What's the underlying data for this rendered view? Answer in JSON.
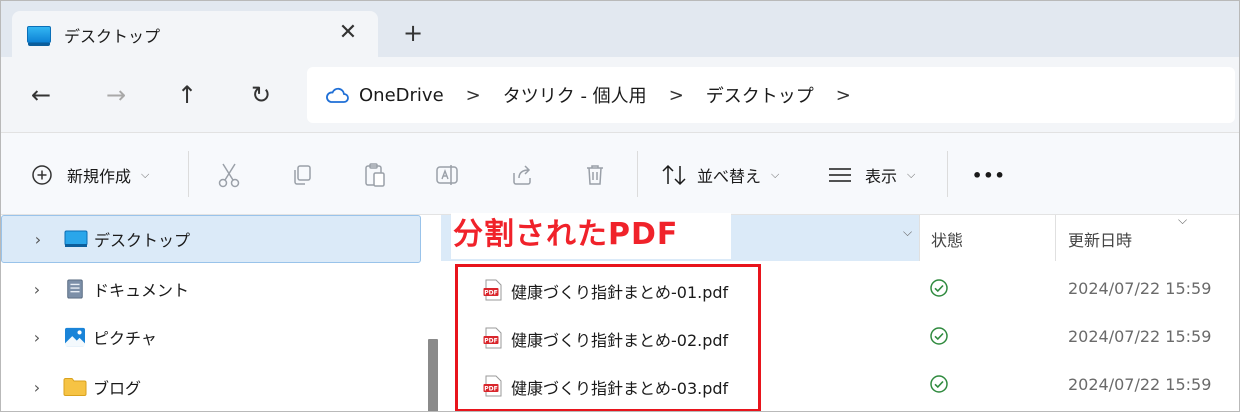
{
  "window": {
    "tab_title": "デスクトップ",
    "tab_close": "✕",
    "new_tab": "+"
  },
  "navigation": {
    "back": "←",
    "forward": "→",
    "up": "↑",
    "refresh": "↻"
  },
  "address_bar": {
    "breadcrumbs": [
      "OneDrive",
      "タツリク - 個人用",
      "デスクトップ"
    ],
    "separator": ">"
  },
  "command_bar": {
    "new_label": "新規作成",
    "sort_label": "並べ替え",
    "view_label": "表示",
    "more_label": "•••",
    "icons": [
      "cut-icon",
      "copy-icon",
      "paste-icon",
      "rename-icon",
      "share-icon",
      "delete-icon"
    ]
  },
  "sidebar": {
    "items": [
      {
        "label": "デスクトップ",
        "icon": "desktop-icon",
        "selected": true
      },
      {
        "label": "ドキュメント",
        "icon": "documents-icon",
        "selected": false
      },
      {
        "label": "ピクチャ",
        "icon": "pictures-icon",
        "selected": false
      },
      {
        "label": "ブログ",
        "icon": "folder-icon",
        "selected": false
      }
    ]
  },
  "file_list": {
    "columns": {
      "status": "状態",
      "modified": "更新日時"
    },
    "annotation": "分割されたPDF",
    "rows": [
      {
        "name": "健康づくり指針まとめ-01.pdf",
        "status": "synced",
        "modified": "2024/07/22 15:59"
      },
      {
        "name": "健康づくり指針まとめ-02.pdf",
        "status": "synced",
        "modified": "2024/07/22 15:59"
      },
      {
        "name": "健康づくり指針まとめ-03.pdf",
        "status": "synced",
        "modified": "2024/07/22 15:59"
      }
    ]
  },
  "colors": {
    "accent": "#0e83d6",
    "highlight": "#e8141c",
    "annotation_text": "#f0222a",
    "status_ok": "#2f8a3e",
    "selected_bg": "#dbeaf8"
  }
}
